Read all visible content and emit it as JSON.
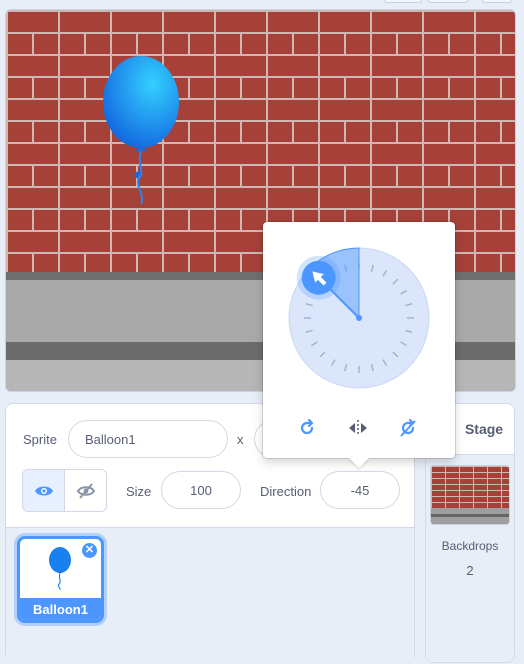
{
  "sprite_info": {
    "sprite_label": "Sprite",
    "sprite_name": "Balloon1",
    "x_label": "x",
    "size_label": "Size",
    "size_value": "100",
    "direction_label": "Direction",
    "direction_value": "-45"
  },
  "sprites": [
    {
      "name": "Balloon1",
      "selected": true
    }
  ],
  "stage_panel": {
    "title": "Stage",
    "backdrops_label": "Backdrops",
    "backdrops_count": "2"
  },
  "direction_dial": {
    "direction_degrees": -45,
    "rotation_styles": [
      "all-around",
      "left-right",
      "dont-rotate"
    ],
    "active_style": "dont-rotate"
  },
  "colors": {
    "accent": "#4c97ff",
    "text": "#575e75",
    "panel_bg": "#e8eef8"
  }
}
